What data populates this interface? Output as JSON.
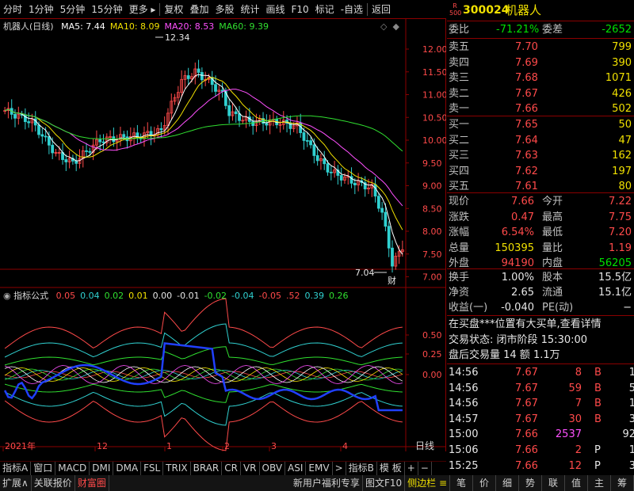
{
  "toolbar": {
    "items": [
      "分时",
      "1分钟",
      "5分钟",
      "15分钟",
      "更多 ▸",
      "复权",
      "叠加",
      "多股",
      "统计",
      "画线",
      "F10",
      "标记",
      "-自选",
      "返回"
    ]
  },
  "chart": {
    "title": "机器人(日线)",
    "ma": [
      {
        "label": "MA5: 7.44",
        "color": "#ffffff"
      },
      {
        "label": "MA10: 8.09",
        "color": "#f0e000"
      },
      {
        "label": "MA20: 8.53",
        "color": "#ff50ff"
      },
      {
        "label": "MA60: 9.39",
        "color": "#30e030"
      }
    ],
    "price_axis": [
      "12.00",
      "11.50",
      "11.00",
      "10.50",
      "10.00",
      "9.50",
      "9.00",
      "8.50",
      "8.00",
      "7.50",
      "7.00"
    ],
    "high_label": "12.34",
    "low_label": "7.04",
    "cai_badge": "财"
  },
  "indicator": {
    "title": "指标公式",
    "values": [
      {
        "v": "0.05",
        "c": "#ff4a4a"
      },
      {
        "v": "0.04",
        "c": "#30d0d0"
      },
      {
        "v": "0.02",
        "c": "#30e030"
      },
      {
        "v": "0.01",
        "c": "#f0e000"
      },
      {
        "v": "0.00",
        "c": "#e6e6e6"
      },
      {
        "v": "-0.01",
        "c": "#e6e6e6"
      },
      {
        "v": "-0.02",
        "c": "#30e030"
      },
      {
        "v": "-0.04",
        "c": "#30d0d0"
      },
      {
        "v": "-0.05",
        "c": "#ff4a4a"
      },
      {
        "v": ".52",
        "c": "#ff4a4a"
      },
      {
        "v": "0.39",
        "c": "#30d0d0"
      },
      {
        "v": "0.26",
        "c": "#30e030"
      }
    ],
    "axis": [
      "0.50",
      "0.25",
      "0.00"
    ]
  },
  "date_axis": {
    "labels": [
      "2021年",
      "12",
      "1",
      "2",
      "3",
      "4"
    ],
    "right_label": "日线"
  },
  "tabs": [
    "指标A",
    "窗口",
    "MACD",
    "DMI",
    "DMA",
    "FSL",
    "TRIX",
    "BRAR",
    "CR",
    "VR",
    "OBV",
    "ASI",
    "EMV",
    ">",
    "指标B",
    "模 板",
    "+",
    "−"
  ],
  "status": {
    "left": [
      "扩展∧",
      "关联报价",
      "财富圈"
    ],
    "middle": [
      "新用户福利专享",
      "图文F10",
      "侧边栏 ≡"
    ],
    "right": [
      "笔",
      "价",
      "细",
      "势",
      "联",
      "值",
      "主",
      "筹"
    ]
  },
  "quote": {
    "badge_r": "R",
    "badge_500": "500",
    "code": "300024",
    "name": "机器人",
    "weibi_label": "委比",
    "weibi_value": "-71.21%",
    "weicha_label": "委差",
    "weicha_value": "-2652",
    "sell": [
      {
        "label": "卖五",
        "price": "7.70",
        "vol": "799"
      },
      {
        "label": "卖四",
        "price": "7.69",
        "vol": "390"
      },
      {
        "label": "卖三",
        "price": "7.68",
        "vol": "1071"
      },
      {
        "label": "卖二",
        "price": "7.67",
        "vol": "426"
      },
      {
        "label": "卖一",
        "price": "7.66",
        "vol": "502"
      }
    ],
    "buy": [
      {
        "label": "买一",
        "price": "7.65",
        "vol": "50"
      },
      {
        "label": "买二",
        "price": "7.64",
        "vol": "47"
      },
      {
        "label": "买三",
        "price": "7.63",
        "vol": "162"
      },
      {
        "label": "买四",
        "price": "7.62",
        "vol": "197"
      },
      {
        "label": "买五",
        "price": "7.61",
        "vol": "80"
      }
    ],
    "stats": [
      {
        "l1": "现价",
        "v1": "7.66",
        "c1": "red",
        "l2": "今开",
        "v2": "7.22",
        "c2": "red"
      },
      {
        "l1": "涨跌",
        "v1": "0.47",
        "c1": "red",
        "l2": "最高",
        "v2": "7.75",
        "c2": "red"
      },
      {
        "l1": "涨幅",
        "v1": "6.54%",
        "c1": "red",
        "l2": "最低",
        "v2": "7.20",
        "c2": "red"
      },
      {
        "l1": "总量",
        "v1": "150395",
        "c1": "yel",
        "l2": "量比",
        "v2": "1.19",
        "c2": "red"
      },
      {
        "l1": "外盘",
        "v1": "94190",
        "c1": "red",
        "l2": "内盘",
        "v2": "56205",
        "c2": "grn"
      }
    ],
    "stats2": [
      {
        "l1": "换手",
        "v1": "1.00%",
        "c1": "wht",
        "l2": "股本",
        "v2": "15.5亿",
        "c2": "wht"
      },
      {
        "l1": "净资",
        "v1": "2.65",
        "c1": "wht",
        "l2": "流通",
        "v2": "15.1亿",
        "c2": "wht"
      },
      {
        "l1": "收益(一)",
        "v1": "-0.040",
        "c1": "wht",
        "l2": "PE(动)",
        "v2": "−",
        "c2": "wht"
      }
    ],
    "notice": "在买盘***位置有大买单,查看详情",
    "trade_state": "交易状态: 闭市阶段 15:30:00",
    "after_hours": "盘后交易量 14 额 1.1万"
  },
  "ticks": [
    {
      "t": "14:56",
      "p": "7.67",
      "v": "8",
      "bs": "B",
      "n": "1",
      "vc": "red"
    },
    {
      "t": "14:56",
      "p": "7.67",
      "v": "59",
      "bs": "B",
      "n": "5",
      "vc": "red"
    },
    {
      "t": "14:56",
      "p": "7.67",
      "v": "7",
      "bs": "B",
      "n": "1",
      "vc": "red"
    },
    {
      "t": "14:57",
      "p": "7.67",
      "v": "30",
      "bs": "B",
      "n": "3",
      "vc": "red"
    },
    {
      "t": "15:00",
      "p": "7.66",
      "v": "2537",
      "bs": "",
      "n": "92",
      "vc": "mag"
    },
    {
      "t": "15:06",
      "p": "7.66",
      "v": "2",
      "bs": "P",
      "n": "1",
      "vc": "red"
    },
    {
      "t": "15:25",
      "p": "7.66",
      "v": "12",
      "bs": "P",
      "n": "3",
      "vc": "red"
    }
  ]
}
